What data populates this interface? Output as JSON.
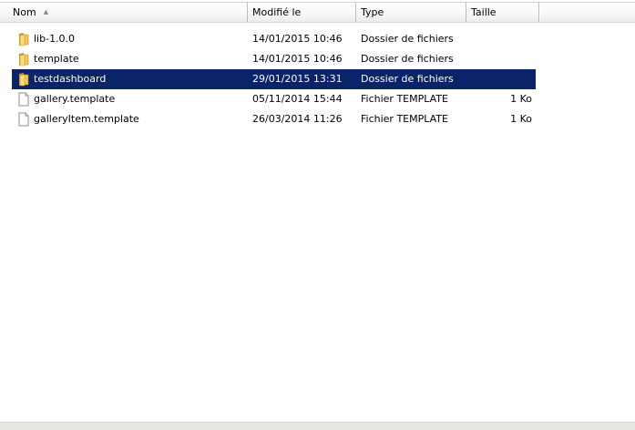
{
  "columns": {
    "name": "Nom",
    "date": "Modifié le",
    "type": "Type",
    "size": "Taille"
  },
  "files": [
    {
      "name": "lib-1.0.0",
      "date": "14/01/2015 10:46",
      "type": "Dossier de fichiers",
      "size": "",
      "icon": "folder-icon",
      "selected": false
    },
    {
      "name": "template",
      "date": "14/01/2015 10:46",
      "type": "Dossier de fichiers",
      "size": "",
      "icon": "folder-icon",
      "selected": false
    },
    {
      "name": "testdashboard",
      "date": "29/01/2015 13:31",
      "type": "Dossier de fichiers",
      "size": "",
      "icon": "folder-icon",
      "selected": true
    },
    {
      "name": "gallery.template",
      "date": "05/11/2014 15:44",
      "type": "Fichier TEMPLATE",
      "size": "1 Ko",
      "icon": "file-icon",
      "selected": false
    },
    {
      "name": "galleryItem.template",
      "date": "26/03/2014 11:26",
      "type": "Fichier TEMPLATE",
      "size": "1 Ko",
      "icon": "file-icon",
      "selected": false
    }
  ],
  "colors": {
    "selection": "#0a246a",
    "folder": "#f2c94c"
  }
}
